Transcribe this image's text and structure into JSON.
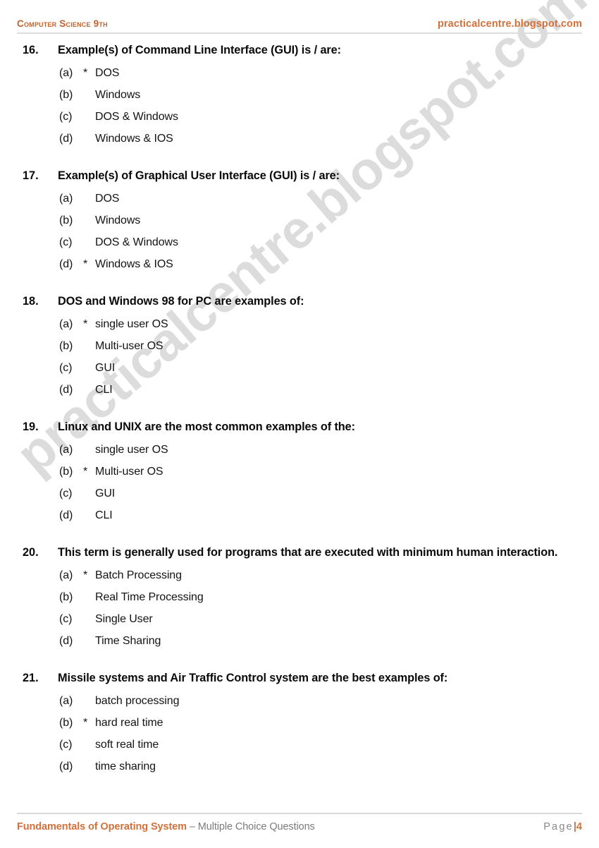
{
  "header": {
    "left_title": "Computer Science 9th",
    "right_site": "practicalcentre.blogspot.com"
  },
  "watermark": {
    "text": "practicalcentre.blogspot.com",
    "color": "#dcdcdc"
  },
  "colors": {
    "accent_orange": "#d4703a",
    "header_orange": "#c2622c",
    "footer_gray": "#7b7b7b",
    "rule_gray": "#dddddd",
    "body_text": "#0a0a0a"
  },
  "questions": [
    {
      "number": "16.",
      "text": "Example(s) of Command Line Interface (GUI) is / are:",
      "multiline": false,
      "options": [
        {
          "label": "(a)",
          "marker": "*",
          "text": "DOS"
        },
        {
          "label": "(b)",
          "marker": "",
          "text": "Windows"
        },
        {
          "label": "(c)",
          "marker": "",
          "text": "DOS & Windows"
        },
        {
          "label": "(d)",
          "marker": "",
          "text": "Windows & IOS"
        }
      ]
    },
    {
      "number": "17.",
      "text": "Example(s) of Graphical User Interface (GUI) is / are:",
      "multiline": false,
      "options": [
        {
          "label": "(a)",
          "marker": "",
          "text": "DOS"
        },
        {
          "label": "(b)",
          "marker": "",
          "text": "Windows"
        },
        {
          "label": "(c)",
          "marker": "",
          "text": "DOS & Windows"
        },
        {
          "label": "(d)",
          "marker": "*",
          "text": "Windows & IOS"
        }
      ]
    },
    {
      "number": "18.",
      "text": "DOS and Windows 98 for PC are examples of:",
      "multiline": false,
      "options": [
        {
          "label": "(a)",
          "marker": "*",
          "text": "single user OS"
        },
        {
          "label": "(b)",
          "marker": "",
          "text": "Multi-user OS"
        },
        {
          "label": "(c)",
          "marker": "",
          "text": "GUI"
        },
        {
          "label": "(d)",
          "marker": "",
          "text": "CLI"
        }
      ]
    },
    {
      "number": "19.",
      "text": "Linux and UNIX are the most common examples of the:",
      "multiline": false,
      "options": [
        {
          "label": "(a)",
          "marker": "",
          "text": "single user OS"
        },
        {
          "label": "(b)",
          "marker": "*",
          "text": "Multi-user OS"
        },
        {
          "label": "(c)",
          "marker": "",
          "text": "GUI"
        },
        {
          "label": "(d)",
          "marker": "",
          "text": "CLI"
        }
      ]
    },
    {
      "number": "20.",
      "text": "This term is generally used for programs that are executed with minimum human interaction.",
      "multiline": true,
      "options": [
        {
          "label": "(a)",
          "marker": "*",
          "text": "Batch Processing"
        },
        {
          "label": "(b)",
          "marker": "",
          "text": "Real Time Processing"
        },
        {
          "label": "(c)",
          "marker": "",
          "text": "Single User"
        },
        {
          "label": "(d)",
          "marker": "",
          "text": "Time Sharing"
        }
      ]
    },
    {
      "number": "21.",
      "text": "Missile systems and Air Traffic Control system are the best examples of:",
      "multiline": false,
      "options": [
        {
          "label": "(a)",
          "marker": "",
          "text": "batch processing"
        },
        {
          "label": "(b)",
          "marker": "*",
          "text": "hard real time"
        },
        {
          "label": "(c)",
          "marker": "",
          "text": "soft real time"
        },
        {
          "label": "(d)",
          "marker": "",
          "text": "time sharing"
        }
      ]
    }
  ],
  "footer": {
    "title": "Fundamentals of Operating System",
    "subtitle": " – Multiple Choice Questions",
    "page_word": "Page",
    "page_separator": "|",
    "page_number": "4"
  }
}
